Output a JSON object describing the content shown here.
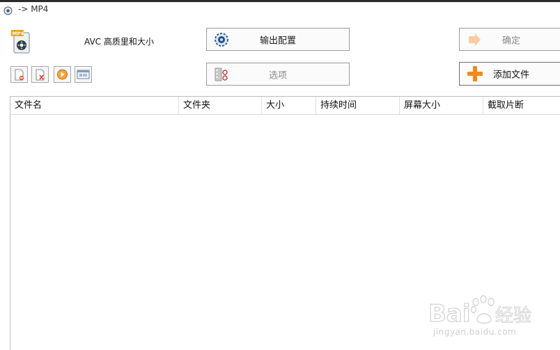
{
  "window": {
    "title": "-> MP4"
  },
  "profile": {
    "label": "AVC 高质里和大小"
  },
  "buttons": {
    "output_config": "输出配置",
    "options": "选项",
    "confirm": "确定",
    "add_file": "添加文件"
  },
  "table": {
    "columns": [
      "文件名",
      "文件夹",
      "大小",
      "持续时间",
      "屏幕大小",
      "截取片断"
    ]
  },
  "watermark": {
    "brand": "Bai",
    "brand2": "经验",
    "url": "jingyan.baidu.com"
  },
  "colors": {
    "accent_orange": "#f08a1c",
    "disabled_text": "#8a8a8a",
    "border": "#9a9a9a"
  }
}
